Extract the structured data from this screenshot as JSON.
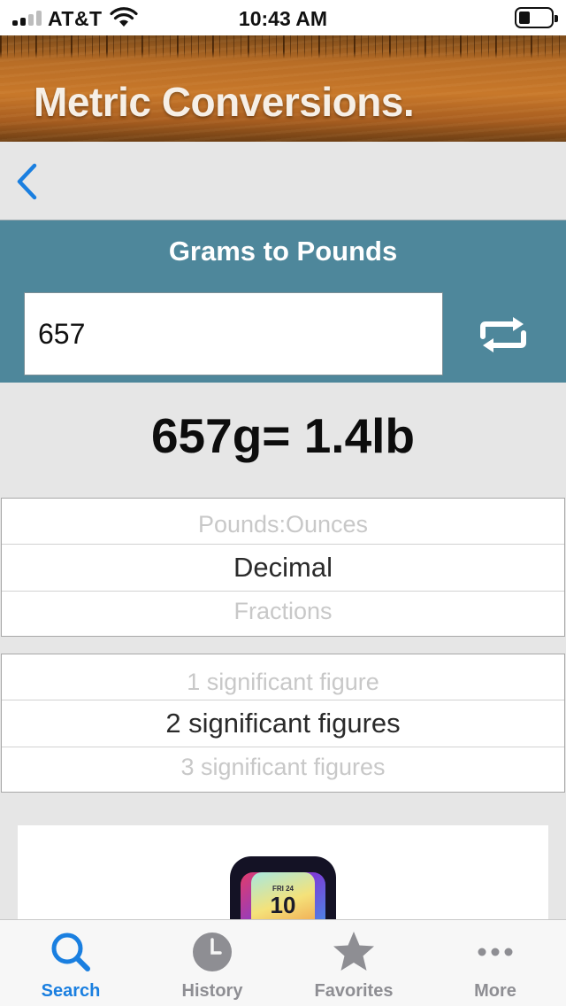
{
  "status_bar": {
    "carrier": "AT&T",
    "time": "10:43 AM"
  },
  "banner": {
    "title": "Metric Conversions."
  },
  "nav": {
    "back_icon": "chevron-left-icon"
  },
  "converter": {
    "title": "Grams to Pounds",
    "input_value": "657",
    "swap_icon": "swap-arrows-icon"
  },
  "result": {
    "text": "657g= 1.4lb"
  },
  "format_picker": {
    "above": "Pounds:Ounces",
    "selected": "Decimal",
    "below": "Fractions"
  },
  "precision_picker": {
    "above": "1 significant figure",
    "selected": "2 significant figures",
    "below": "3 significant figures"
  },
  "ad": {
    "icon_day": "FRI 24",
    "icon_number": "10"
  },
  "tabs": [
    {
      "label": "Search",
      "icon": "search-icon",
      "active": true
    },
    {
      "label": "History",
      "icon": "clock-icon",
      "active": false
    },
    {
      "label": "Favorites",
      "icon": "star-icon",
      "active": false
    },
    {
      "label": "More",
      "icon": "more-icon",
      "active": false
    }
  ],
  "colors": {
    "accent": "#1a7fe0",
    "panel": "#4e879b",
    "background": "#e6e6e6",
    "tab_inactive": "#8e8e93"
  }
}
